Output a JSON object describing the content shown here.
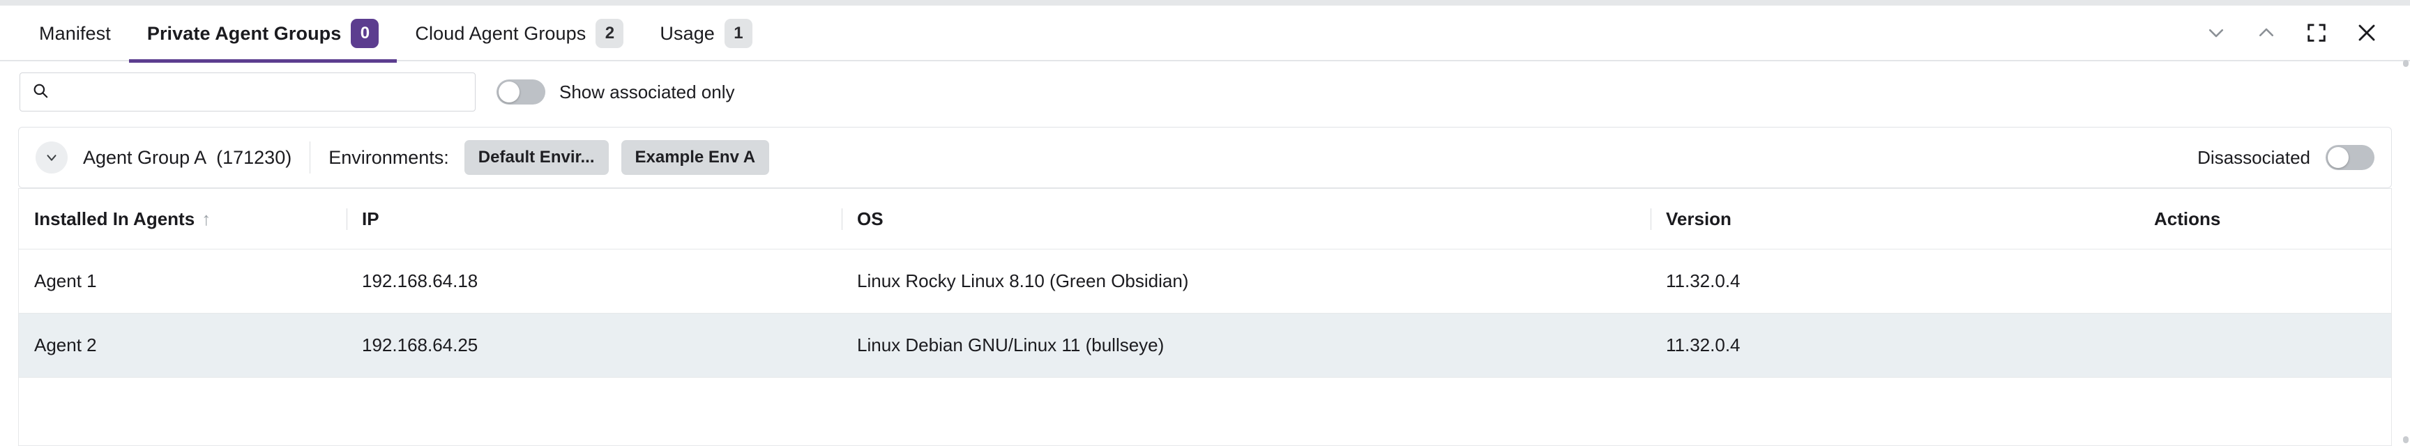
{
  "window": {
    "controls": [
      {
        "name": "chevron-down-icon",
        "title": "Minimize"
      },
      {
        "name": "chevron-up-icon",
        "title": "Restore"
      },
      {
        "name": "fullscreen-icon",
        "title": "Fullscreen"
      },
      {
        "name": "close-icon",
        "title": "Close"
      }
    ]
  },
  "tabs": [
    {
      "label": "Manifest",
      "badge": null,
      "active": false
    },
    {
      "label": "Private Agent Groups",
      "badge": "0",
      "active": true
    },
    {
      "label": "Cloud Agent Groups",
      "badge": "2",
      "active": false
    },
    {
      "label": "Usage",
      "badge": "1",
      "active": false
    }
  ],
  "toolbar": {
    "search_value": "",
    "search_placeholder": "",
    "show_associated_label": "Show associated only",
    "show_associated_on": false
  },
  "group": {
    "title": "Agent Group A",
    "count": "(171230)",
    "environments_label": "Environments:",
    "chips": [
      "Default Envir...",
      "Example Env A"
    ],
    "disassociated_label": "Disassociated",
    "disassociated_on": false
  },
  "table": {
    "columns": [
      {
        "label": "Installed In Agents",
        "sort": "asc"
      },
      {
        "label": "IP",
        "sort": null
      },
      {
        "label": "OS",
        "sort": null
      },
      {
        "label": "Version",
        "sort": null
      },
      {
        "label": "Actions",
        "sort": null
      }
    ],
    "sort_arrow_glyph": "↑",
    "rows": [
      {
        "agent": "Agent 1",
        "ip": "192.168.64.18",
        "os": "Linux Rocky Linux 8.10 (Green Obsidian)",
        "version": "11.32.0.4",
        "actions": ""
      },
      {
        "agent": "Agent 2",
        "ip": "192.168.64.25",
        "os": "Linux Debian GNU/Linux 11 (bullseye)",
        "version": "11.32.0.4",
        "actions": ""
      }
    ]
  },
  "colors": {
    "accent": "#5c3d8f",
    "badge_neutral": "#e2e4e6",
    "row_alt": "#eaeff2",
    "chip": "#d7dadd",
    "border": "#e6e8ea"
  }
}
